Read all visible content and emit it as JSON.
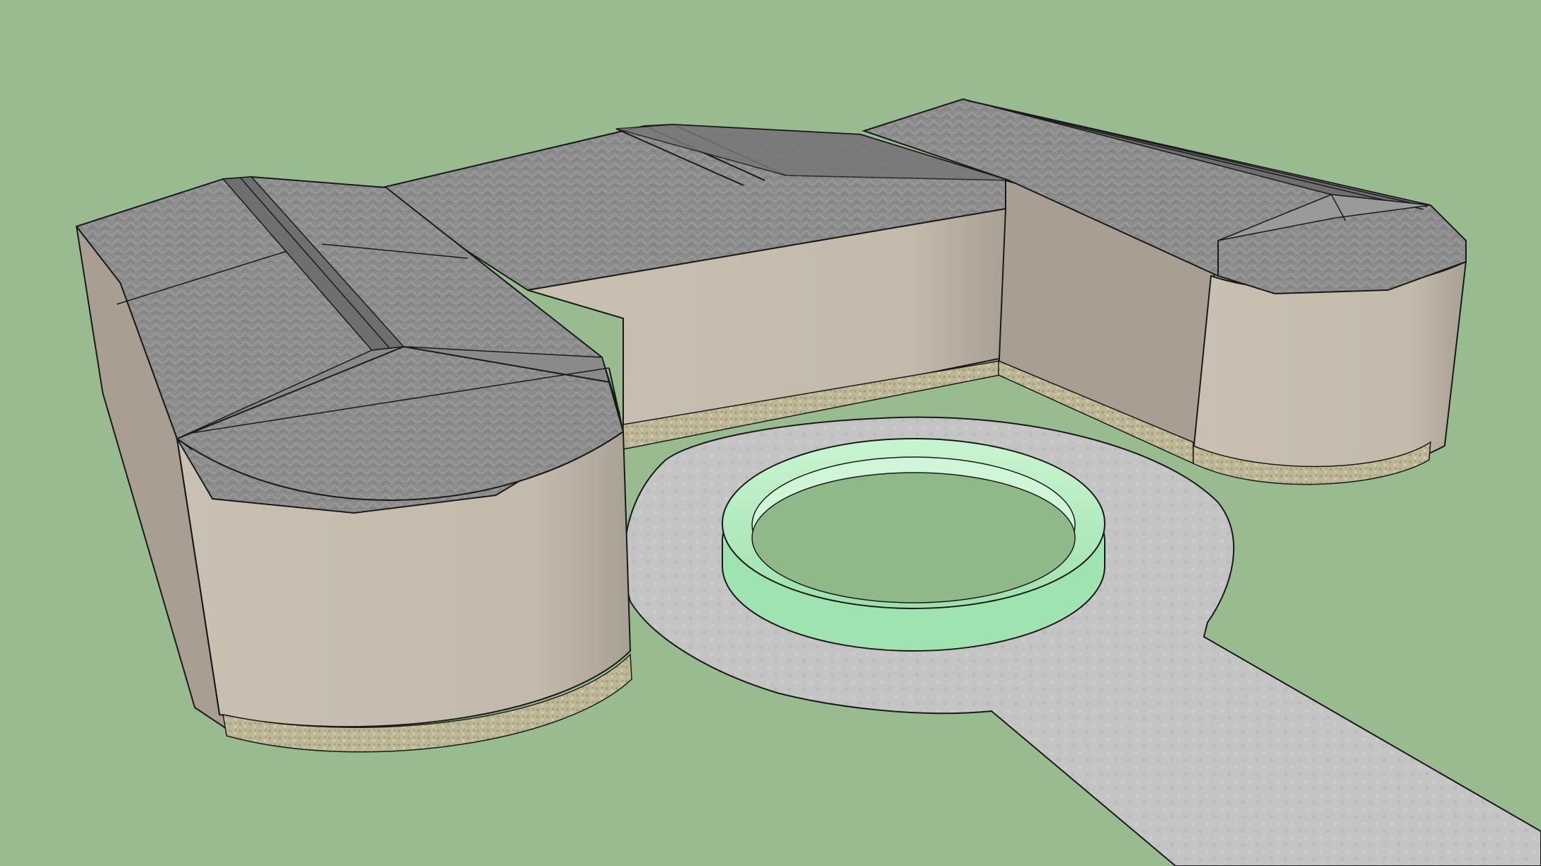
{
  "scene": {
    "description_visible_text": "",
    "palette": {
      "ground": "#98bc8f",
      "plaza": "#c4c4c4",
      "roof": "#8a8a8a",
      "roof_dark": "#707070",
      "roof_light": "#9d9d9d",
      "wall": "#c5bcae",
      "wall_shade": "#a89f93",
      "base_stone": "#bdb697",
      "ring": "#b8f0c4",
      "ring_inner": "#90b98a",
      "edge": "#1a1a1a"
    }
  }
}
